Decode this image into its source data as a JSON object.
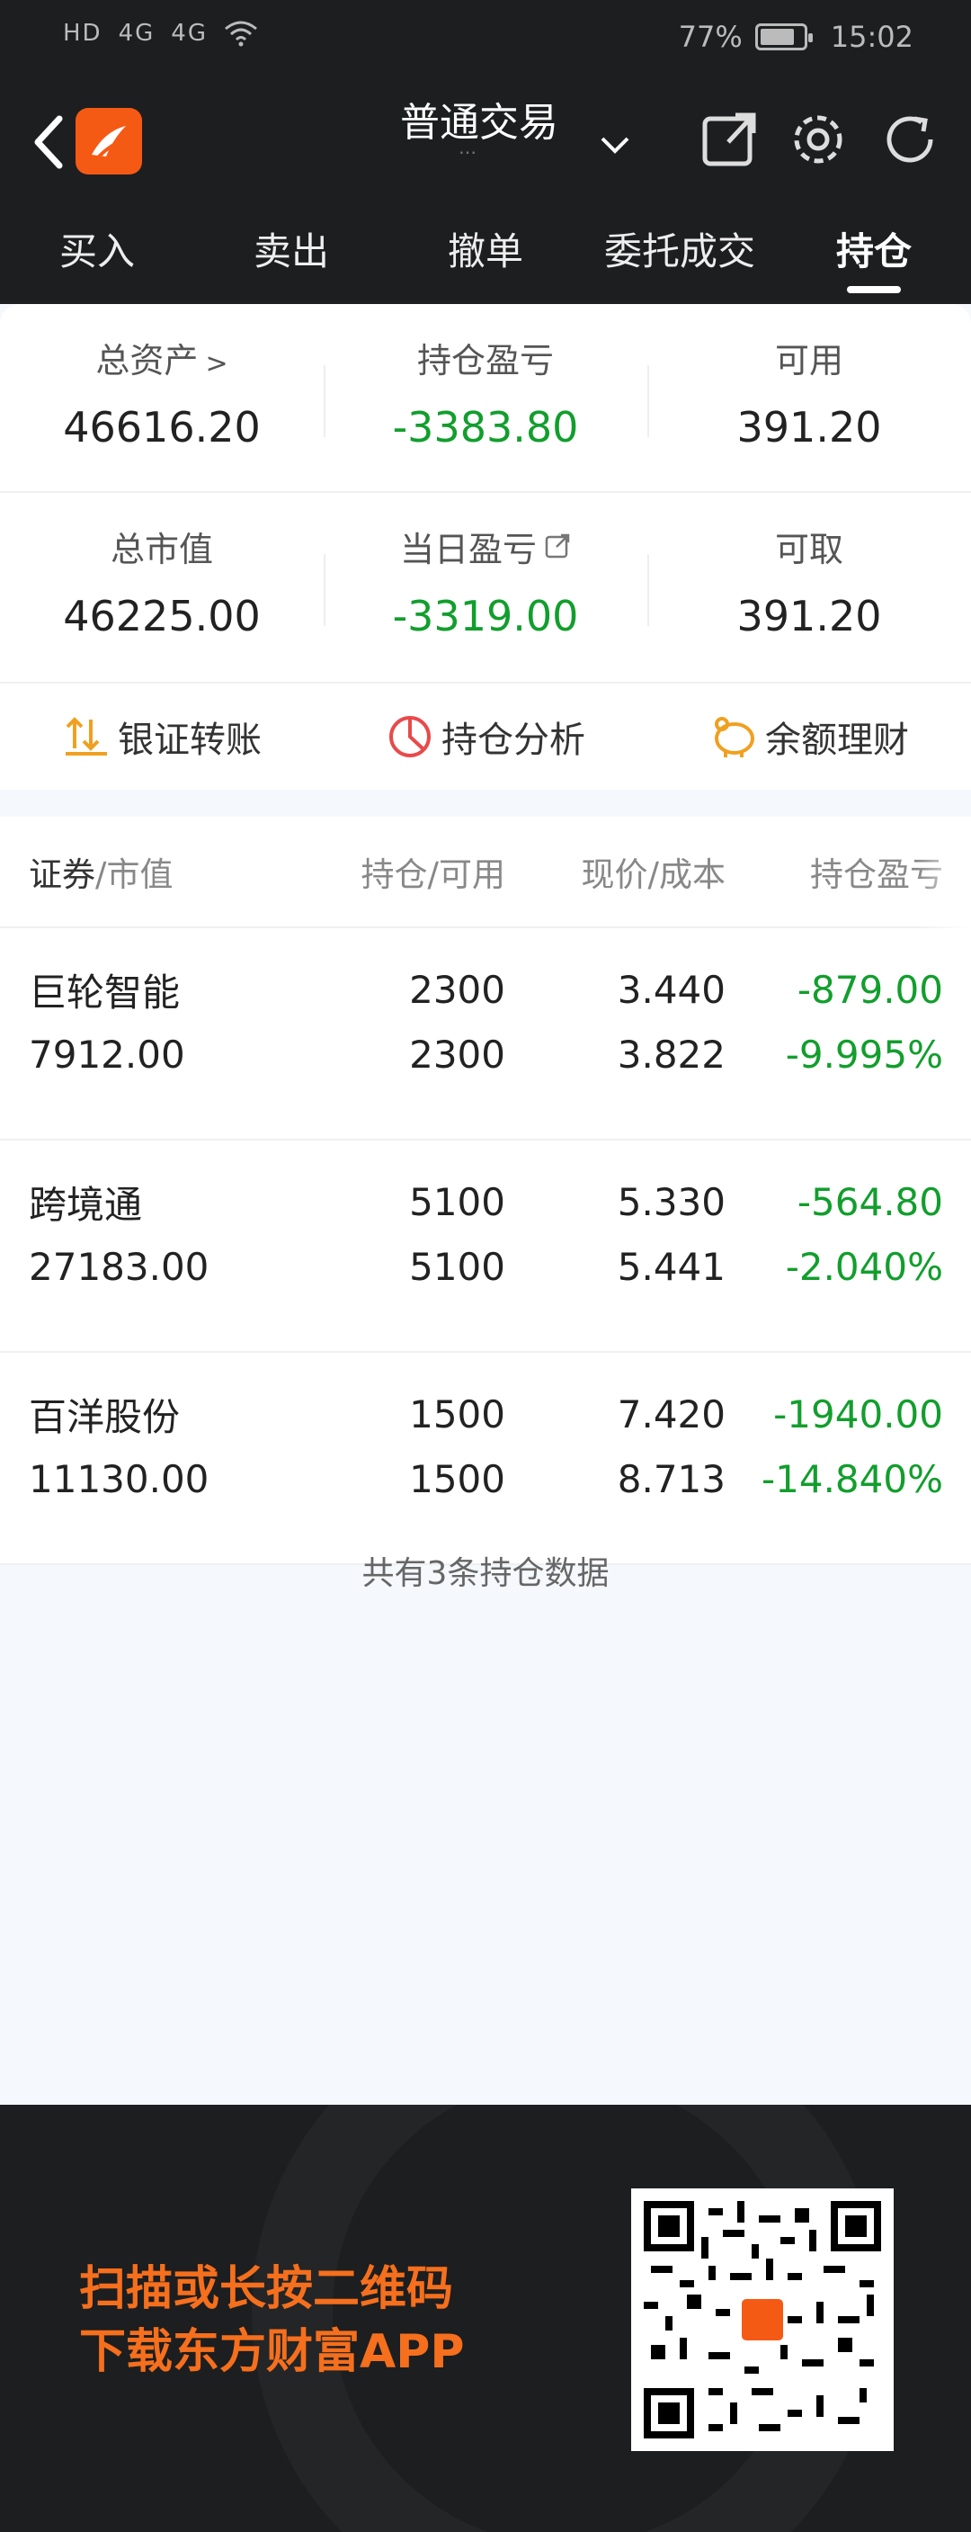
{
  "status_bar": {
    "left": [
      "HD",
      "4G",
      "4G"
    ],
    "battery": "77%",
    "time": "15:02"
  },
  "header": {
    "title": "普通交易",
    "subtitle": "…"
  },
  "tabs": [
    "买入",
    "卖出",
    "撤单",
    "委托成交",
    "持仓"
  ],
  "active_tab": "持仓",
  "summary": {
    "total_assets_label": "总资产",
    "total_assets": "46616.20",
    "position_pl_label": "持仓盈亏",
    "position_pl": "-3383.80",
    "available_label": "可用",
    "available": "391.20",
    "market_value_label": "总市值",
    "market_value": "46225.00",
    "daily_pl_label": "当日盈亏",
    "daily_pl": "-3319.00",
    "withdrawable_label": "可取",
    "withdrawable": "391.20"
  },
  "actions": {
    "transfer": "银证转账",
    "analysis": "持仓分析",
    "finance": "余额理财"
  },
  "table": {
    "headers": {
      "security": "证券",
      "market_value": "/市值",
      "position": "持仓/可用",
      "price": "现价/成本",
      "pl": "持仓盈亏"
    },
    "rows": [
      {
        "name": "巨轮智能",
        "value": "7912.00",
        "position": "2300",
        "available": "2300",
        "price": "3.440",
        "cost": "3.822",
        "pl": "-879.00",
        "pl_pct": "-9.995%"
      },
      {
        "name": "跨境通",
        "value": "27183.00",
        "position": "5100",
        "available": "5100",
        "price": "5.330",
        "cost": "5.441",
        "pl": "-564.80",
        "pl_pct": "-2.040%"
      },
      {
        "name": "百洋股份",
        "value": "11130.00",
        "position": "1500",
        "available": "1500",
        "price": "7.420",
        "cost": "8.713",
        "pl": "-1940.00",
        "pl_pct": "-14.840%"
      }
    ]
  },
  "footnote": "共有3条持仓数据",
  "banner": {
    "line1": "扫描或长按二维码",
    "line2": "下载东方财富APP"
  },
  "colors": {
    "brand": "#f55a14",
    "negative": "#129e2d",
    "dark_bg": "#1d1e20"
  }
}
